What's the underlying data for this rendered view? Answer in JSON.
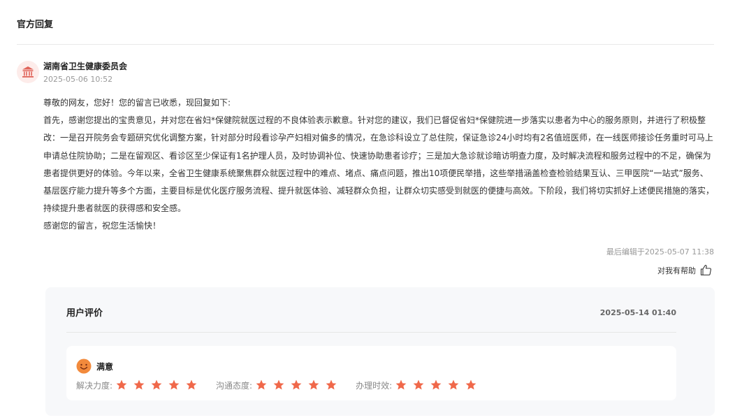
{
  "section_title": "官方回复",
  "reply": {
    "org_name": "湖南省卫生健康委员会",
    "time": "2025-05-06 10:52",
    "paragraphs": [
      "尊敬的网友，您好！您的留言已收悉，现回复如下:",
      "首先，感谢您提出的宝贵意见，并对您在省妇*保健院就医过程的不良体验表示歉意。针对您的建议，我们已督促省妇*保健院进一步落实以患者为中心的服务原则，并进行了积极整改：一是召开院务会专题研究优化调整方案，针对部分时段看诊孕产妇相对偏多的情况，在急诊科设立了总住院，保证急诊24小时均有2名值班医师，在一线医师接诊任务重时可马上申请总住院协助；二是在留观区、看诊区至少保证有1名护理人员，及时协调补位、快速协助患者诊疗；三是加大急诊就诊暗访明查力度，及时解决流程和服务过程中的不足，确保为患者提供更好的体验。今年以来，全省卫生健康系统聚焦群众就医过程中的难点、堵点、痛点问题，推出10项便民举措，这些举措涵盖检查检验结果互认、三甲医院“一站式”服务、基层医疗能力提升等多个方面，主要目标是优化医疗服务流程、提升就医体验、减轻群众负担，让群众切实感受到就医的便捷与高效。下阶段，我们将切实抓好上述便民措施的落实，持续提升患者就医的获得感和安全感。",
      "感谢您的留言，祝您生活愉快！"
    ],
    "edited": "最后编辑于2025-05-07 11:38",
    "helpful_label": "对我有帮助"
  },
  "evaluation": {
    "title": "用户评价",
    "time": "2025-05-14 01:40",
    "satisfaction": "满意",
    "ratings": [
      {
        "label": "解决力度:",
        "stars": 5,
        "max": 5
      },
      {
        "label": "沟通态度:",
        "stars": 5,
        "max": 5
      },
      {
        "label": "办理时效:",
        "stars": 5,
        "max": 5
      }
    ]
  },
  "colors": {
    "star": "#f0684a",
    "emoji": "#f28a3c",
    "avatar_icon": "#e0645a"
  },
  "icons": {
    "avatar": "government-building-icon",
    "helpful": "thumbs-up-icon",
    "satisfaction": "smiley-face-icon",
    "rating": "star-icon"
  }
}
